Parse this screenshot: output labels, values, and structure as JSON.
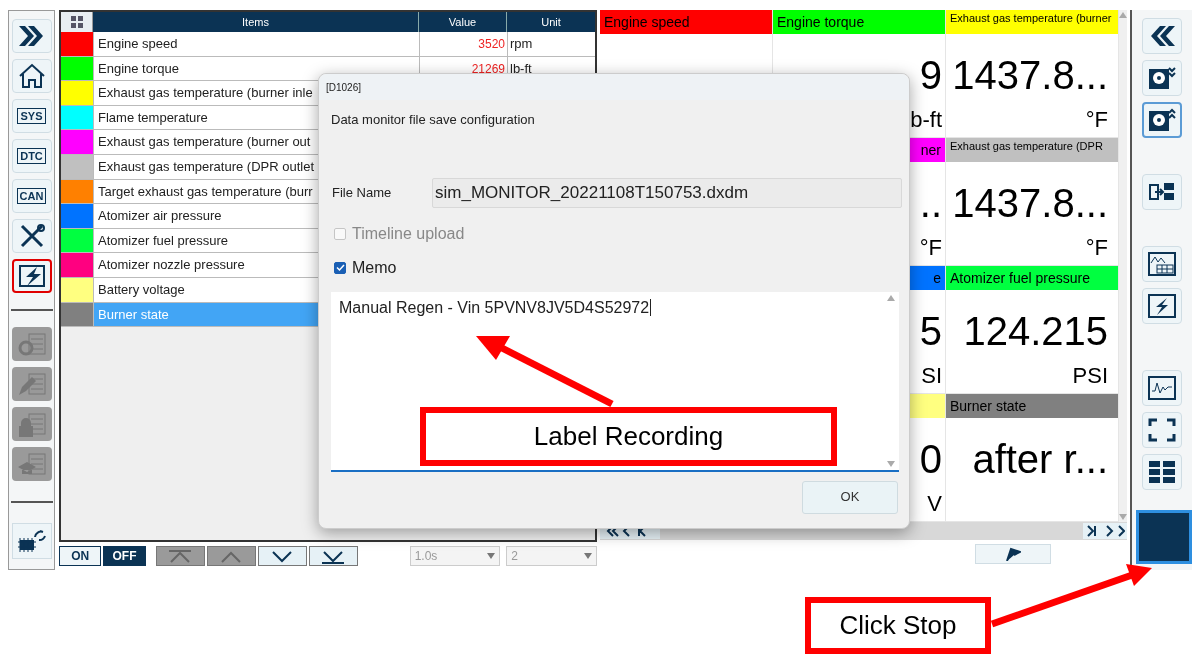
{
  "left_toolbar": [
    {
      "kind": "expand",
      "selected": false
    },
    {
      "kind": "home",
      "selected": false
    },
    {
      "kind": "sys",
      "label": "SYS",
      "selected": false
    },
    {
      "kind": "dtc",
      "label": "DTC",
      "selected": false
    },
    {
      "kind": "can",
      "label": "CAN",
      "selected": false
    },
    {
      "kind": "tools",
      "selected": false
    },
    {
      "kind": "monitor",
      "selected": true
    }
  ],
  "left_toolbar_disabled": [
    {
      "kind": "settings"
    },
    {
      "kind": "edit"
    },
    {
      "kind": "lock"
    },
    {
      "kind": "learn"
    }
  ],
  "table": {
    "columns": [
      "Items",
      "Value",
      "Unit"
    ],
    "rows": [
      {
        "color": "#ff0000",
        "item": "Engine speed",
        "value": "3520",
        "unit": "rpm",
        "selected": false
      },
      {
        "color": "#00ff00",
        "item": "Engine torque",
        "value": "21269",
        "unit": "lb-ft",
        "selected": false
      },
      {
        "color": "#ffff00",
        "item": "Exhaust gas temperature (burner inle",
        "selected": false
      },
      {
        "color": "#00ffff",
        "item": "Flame temperature",
        "selected": false
      },
      {
        "color": "#ff00ff",
        "item": "Exhaust gas temperature (burner out",
        "selected": false
      },
      {
        "color": "#c0c0c0",
        "item": "Exhaust gas temperature (DPR outlet",
        "selected": false
      },
      {
        "color": "#ff8000",
        "item": "Target exhaust gas temperature (burr",
        "selected": false
      },
      {
        "color": "#0073ff",
        "item": "Atomizer air pressure",
        "selected": false
      },
      {
        "color": "#00ff40",
        "item": "Atomizer fuel pressure",
        "selected": false
      },
      {
        "color": "#ff0080",
        "item": "Atomizer nozzle pressure",
        "selected": false
      },
      {
        "color": "#ffff80",
        "item": "Battery voltage",
        "selected": false
      },
      {
        "color": "#808080",
        "item": "Burner state",
        "selected": true
      }
    ]
  },
  "bottom_bar": {
    "on": {
      "label": "ON",
      "selected": false
    },
    "off": {
      "label": "OFF",
      "selected": true
    },
    "scroll_buttons": [
      {
        "kind": "top",
        "disabled": true
      },
      {
        "kind": "up",
        "disabled": true
      },
      {
        "kind": "down",
        "disabled": false
      },
      {
        "kind": "bottom",
        "disabled": false
      }
    ],
    "interval": "1.0s",
    "count": "2"
  },
  "tiles": {
    "column_1": [
      {
        "header": "Engine speed",
        "color": "#ff0000"
      }
    ],
    "column_2": [
      {
        "kind": "full",
        "header": "Engine torque",
        "color": "#00ff00",
        "value": "9",
        "unit": "b-ft"
      },
      {
        "kind": "clipped",
        "header": "ner",
        "color": "#ff00ff",
        "value": "..",
        "unit": "°F"
      },
      {
        "kind": "clipped",
        "header": "e",
        "color": "#0073ff",
        "value": "5",
        "unit": "SI"
      },
      {
        "kind": "clipped",
        "color": "#ffff80",
        "value": "0",
        "unit": "V"
      }
    ],
    "column_3": [
      {
        "header": "Exhaust gas temperature (burner",
        "color": "#ffff00",
        "value": "1437.8...",
        "unit": "°F"
      },
      {
        "header": "Exhaust gas temperature (DPR",
        "color": "#c0c0c0",
        "value": "1437.8...",
        "unit": "°F"
      },
      {
        "header": "Atomizer fuel pressure",
        "color": "#00ff40",
        "value": "124.215",
        "unit": "PSI"
      },
      {
        "header": "Burner state",
        "color": "#808080",
        "value": "after r..."
      }
    ]
  },
  "right_toolbar": [
    {
      "kind": "collapse",
      "selected": false
    },
    {
      "kind": "disk_down",
      "selected": false
    },
    {
      "kind": "disk_up",
      "selected": true
    },
    {
      "kind": "export",
      "selected": false
    },
    {
      "kind": "chart_table",
      "selected": false
    },
    {
      "kind": "flash",
      "selected": false
    },
    {
      "kind": "waveform",
      "selected": false
    },
    {
      "kind": "fullscreen",
      "selected": false
    },
    {
      "kind": "layout",
      "selected": false
    }
  ],
  "stop_button": {
    "selected": true
  },
  "dialog": {
    "title": "[D1026]",
    "heading": "Data monitor file save configuration",
    "file_name_label": "File Name",
    "file_name": "sim_MONITOR_20221108T150753.dxdm",
    "timeline_upload": {
      "label": "Timeline upload",
      "checked": false,
      "disabled": true
    },
    "memo": {
      "label": "Memo",
      "checked": true,
      "disabled": false
    },
    "memo_text": "Manual Regen - Vin 5PVNV8JV5D4S52972",
    "ok": "OK"
  },
  "annotations": [
    "Label Recording",
    "Click Stop"
  ]
}
